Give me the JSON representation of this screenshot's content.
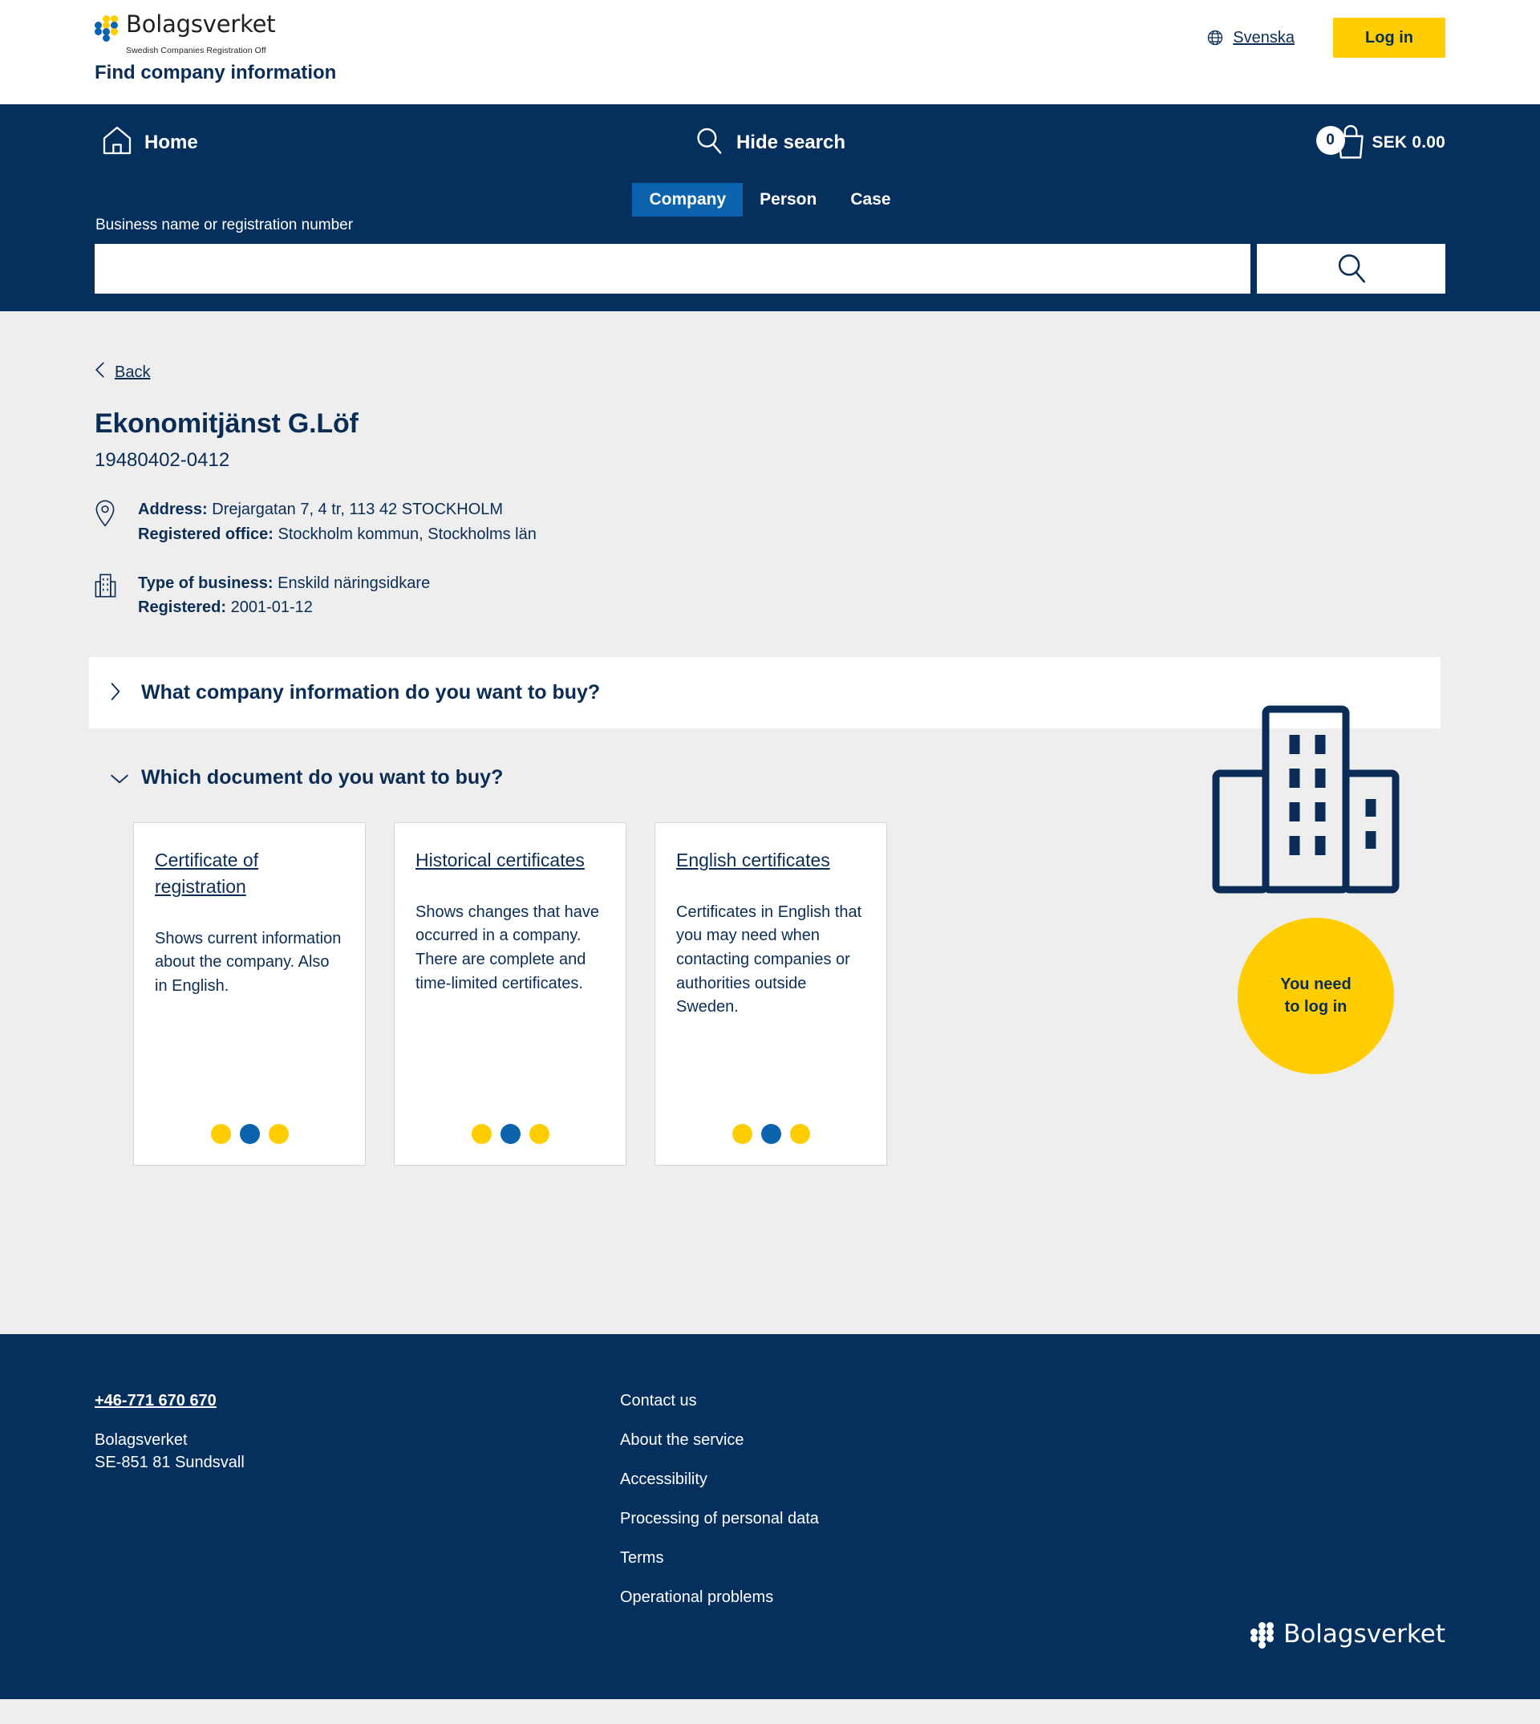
{
  "header": {
    "logo_word": "Bolagsverket",
    "logo_subtitle": "Swedish Companies Registration Off",
    "app_title": "Find company information",
    "language_label": "Svenska",
    "login_label": "Log in"
  },
  "nav": {
    "home_label": "Home",
    "hide_search_label": "Hide search",
    "cart_count": "0",
    "cart_amount": "SEK 0.00",
    "tabs": [
      {
        "label": "Company",
        "active": true
      },
      {
        "label": "Person",
        "active": false
      },
      {
        "label": "Case",
        "active": false
      }
    ],
    "search_label": "Business name or registration number",
    "search_value": "",
    "search_placeholder": ""
  },
  "main": {
    "back_label": "Back",
    "company_name": "Ekonomitjänst G.Löf",
    "registration_number": "19480402-0412",
    "address_label": "Address:",
    "address_value": "Drejargatan 7, 4 tr, 113 42 STOCKHOLM",
    "registered_office_label": "Registered office:",
    "registered_office_value": "Stockholm kommun, Stockholms län",
    "type_of_business_label": "Type of business:",
    "type_of_business_value": "Enskild näringsidkare",
    "registered_label": "Registered:",
    "registered_value": "2001-01-12",
    "login_bubble_line1": "You need",
    "login_bubble_line2": "to log in",
    "accordion_1_title": "What company information do you want to buy?",
    "accordion_2_title": "Which document do you want to buy?",
    "cards": [
      {
        "title": "Certificate of registration",
        "description": "Shows current information about the company. Also in English.",
        "dots": [
          "#ffcd00",
          "#0b63ad",
          "#ffcd00"
        ]
      },
      {
        "title": "Historical certificates",
        "description": "Shows changes that have occurred in a company. There are complete and time-limited certificates.",
        "dots": [
          "#ffcd00",
          "#0b63ad",
          "#ffcd00"
        ]
      },
      {
        "title": "English certificates",
        "description": "Certificates in English that you may need when contacting companies or authorities outside Sweden.",
        "dots": [
          "#ffcd00",
          "#0b63ad",
          "#ffcd00"
        ]
      }
    ]
  },
  "footer": {
    "phone": "+46-771 670 670",
    "org_name": "Bolagsverket",
    "org_address": "SE-851 81 Sundsvall",
    "links": [
      "Contact us",
      "About the service",
      "Accessibility",
      "Processing of personal data",
      "Terms",
      "Operational problems"
    ],
    "logo_word": "Bolagsverket"
  },
  "colors": {
    "navy": "#05305e",
    "yellow": "#ffcd00",
    "blue": "#0b63ad",
    "page_bg": "#eeeeee"
  }
}
